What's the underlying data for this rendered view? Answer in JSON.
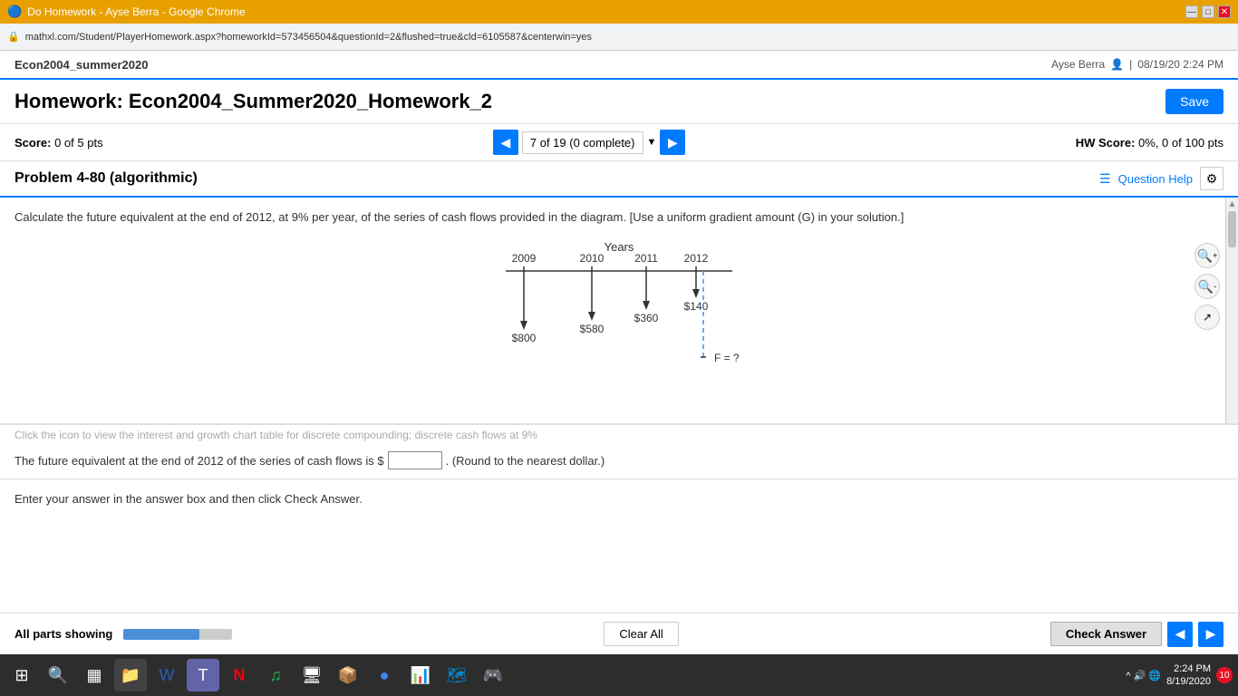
{
  "browser": {
    "title": "Do Homework - Ayse Berra - Google Chrome",
    "url": "mathxl.com/Student/PlayerHomework.aspx?homeworkId=573456504&questionId=2&flushed=true&cld=6105587&centerwin=yes",
    "controls": {
      "minimize": "—",
      "maximize": "□",
      "close": "✕"
    }
  },
  "app_header": {
    "course": "Econ2004_summer2020",
    "user": "Ayse Berra",
    "date": "08/19/20 2:24 PM",
    "separator": "|"
  },
  "homework": {
    "title": "Homework: Econ2004_Summer2020_Homework_2",
    "save_label": "Save"
  },
  "score": {
    "label": "Score:",
    "value": "0 of 5 pts",
    "nav_text": "7 of 19 (0 complete)",
    "hw_score_label": "HW Score:",
    "hw_score_value": "0%, 0 of 100 pts"
  },
  "problem": {
    "title": "Problem 4-80 (algorithmic)",
    "question_help": "Question Help",
    "question_text": "Calculate the future equivalent at the end of 2012, at 9% per year, of the series of cash flows provided in the diagram. [Use a uniform gradient amount (G) in your solution.]"
  },
  "diagram": {
    "years_label": "Years",
    "years": [
      "2009",
      "2010",
      "2011",
      "2012"
    ],
    "cash_flows": [
      {
        "year": "2009",
        "amount": "$800",
        "direction": "down"
      },
      {
        "year": "2010",
        "amount": "$580",
        "direction": "down"
      },
      {
        "year": "2011",
        "amount": "$360",
        "direction": "down"
      },
      {
        "year": "2012",
        "amount": "$140",
        "direction": "down"
      }
    ],
    "future_label": "F = ?"
  },
  "answer": {
    "prefix": "The future equivalent at the end of 2012 of the series of cash flows is $",
    "placeholder": "",
    "suffix": ". (Round to the nearest dollar.)"
  },
  "instruction": {
    "text": "Enter your answer in the answer box and then click Check Answer."
  },
  "bottom_bar": {
    "all_parts_label": "All parts showing",
    "progress_percent": 70,
    "clear_all_label": "Clear All",
    "check_answer_label": "Check Answer"
  },
  "help": {
    "symbol": "?"
  },
  "taskbar": {
    "time": "2:24 PM",
    "date_short": "8/19/2020",
    "icons": [
      "⊞",
      "🔍",
      "📁",
      "📝",
      "📌",
      "📋",
      "N",
      "🎵",
      "🖥",
      "📦",
      "🌐",
      "📊",
      "🗓",
      "🧭",
      "🎮"
    ]
  }
}
